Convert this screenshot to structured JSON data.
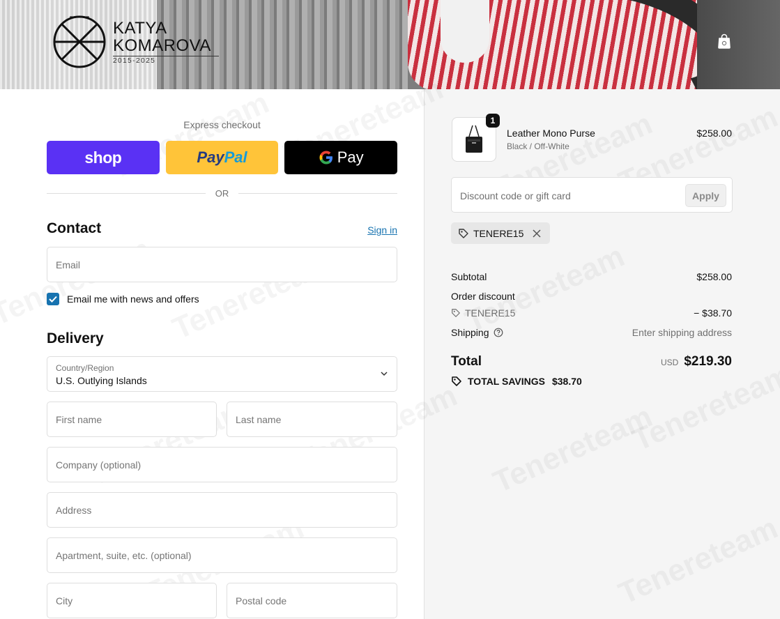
{
  "brand": {
    "name_line1": "KATYA",
    "name_line2": "KOMAROVA",
    "years": "2015-2025"
  },
  "express": {
    "label": "Express checkout",
    "shop_label": "shop",
    "paypal_part1": "Pay",
    "paypal_part2": "Pal",
    "gpay_label": "Pay",
    "or_label": "OR"
  },
  "contact": {
    "title": "Contact",
    "sign_in": "Sign in",
    "email_placeholder": "Email",
    "newsletter_label": "Email me with news and offers",
    "newsletter_checked": true
  },
  "delivery": {
    "title": "Delivery",
    "country_label": "Country/Region",
    "country_value": "U.S. Outlying Islands",
    "first_name_placeholder": "First name",
    "last_name_placeholder": "Last name",
    "company_placeholder": "Company (optional)",
    "address_placeholder": "Address",
    "apartment_placeholder": "Apartment, suite, etc. (optional)",
    "city_placeholder": "City",
    "postal_placeholder": "Postal code"
  },
  "summary": {
    "product": {
      "name": "Leather Mono Purse",
      "variant": "Black / Off-White",
      "price": "$258.00",
      "quantity": "1"
    },
    "discount_placeholder": "Discount code or gift card",
    "apply_label": "Apply",
    "applied_code": "TENERE15",
    "subtotal_label": "Subtotal",
    "subtotal_value": "$258.00",
    "order_discount_label": "Order discount",
    "discount_code": "TENERE15",
    "discount_value": "− $38.70",
    "shipping_label": "Shipping",
    "shipping_value": "Enter shipping address",
    "total_label": "Total",
    "total_currency": "USD",
    "total_value": "$219.30",
    "savings_label": "TOTAL SAVINGS",
    "savings_value": "$38.70"
  },
  "colors": {
    "accent": "#1773b0",
    "shop_purple": "#5a31f4",
    "paypal_yellow": "#ffc439",
    "gpay_black": "#000000"
  },
  "icons": {
    "cart": "shopping-bag-icon",
    "chevron": "chevron-down-icon",
    "tag": "tag-icon",
    "close": "close-icon",
    "help": "question-circle-icon",
    "check": "check-icon"
  }
}
